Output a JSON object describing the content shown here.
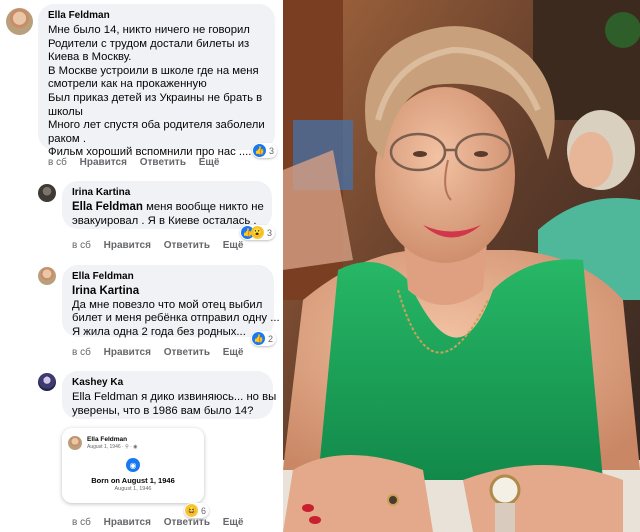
{
  "comments": [
    {
      "author": "Ella Feldman",
      "lines": [
        "Мне было 14, никто ничего не говорил",
        "Родители с трудом достали билеты из",
        "Киева в Москву.",
        "В Москве устроили в школе где на меня",
        "смотрели как на прокаженную",
        "Был приказ детей из Украины не брать в",
        "школы",
        "Много лет спустя оба родителя заболели",
        "раком .",
        "Фильм хороший вспомнили про нас ...."
      ],
      "time": "в сб",
      "like_label": "Нравится",
      "reply_label": "Ответить",
      "more_label": "Ещё",
      "reaction_count": "3"
    },
    {
      "author": "Irina Kartina",
      "mention": "Ella Feldman",
      "lines": [
        " меня вообще никто не",
        "эвакуировал . Я в Киеве осталась ."
      ],
      "time": "в сб",
      "like_label": "Нравится",
      "reply_label": "Ответить",
      "more_label": "Ещё",
      "reaction_count": "3"
    },
    {
      "author": "Ella Feldman",
      "mention": "Irina Kartina",
      "lines": [
        "Да мне повезло что мой отец выбил",
        "билет и меня ребёнка отправил одну ...",
        "Я жила одна 2 года без родных..."
      ],
      "time": "в сб",
      "like_label": "Нравится",
      "reply_label": "Ответить",
      "more_label": "Ещё",
      "reaction_count": "2"
    },
    {
      "author": "Kashey Ka",
      "mention": "Ella Feldman",
      "lines": [
        " я дико извиняюсь... но вы",
        "уверены, что в 1986 вам было 14?"
      ],
      "time": "в сб",
      "like_label": "Нравится",
      "reply_label": "Ответить",
      "more_label": "Ещё",
      "reaction_count": "6"
    }
  ],
  "attachment": {
    "name": "Ella Feldman",
    "meta": "August 1, 1946 · ⚲ · ◉",
    "title": "Born on August 1, 1946",
    "date": "August 1, 1946"
  },
  "icons": {
    "like": "thumbs-up-icon",
    "wow": "wow-icon",
    "haha": "haha-icon",
    "baby": "baby-icon"
  },
  "colors": {
    "accent": "#1877f2",
    "bubble": "#f0f2f5",
    "dress": "#1fa85a"
  }
}
